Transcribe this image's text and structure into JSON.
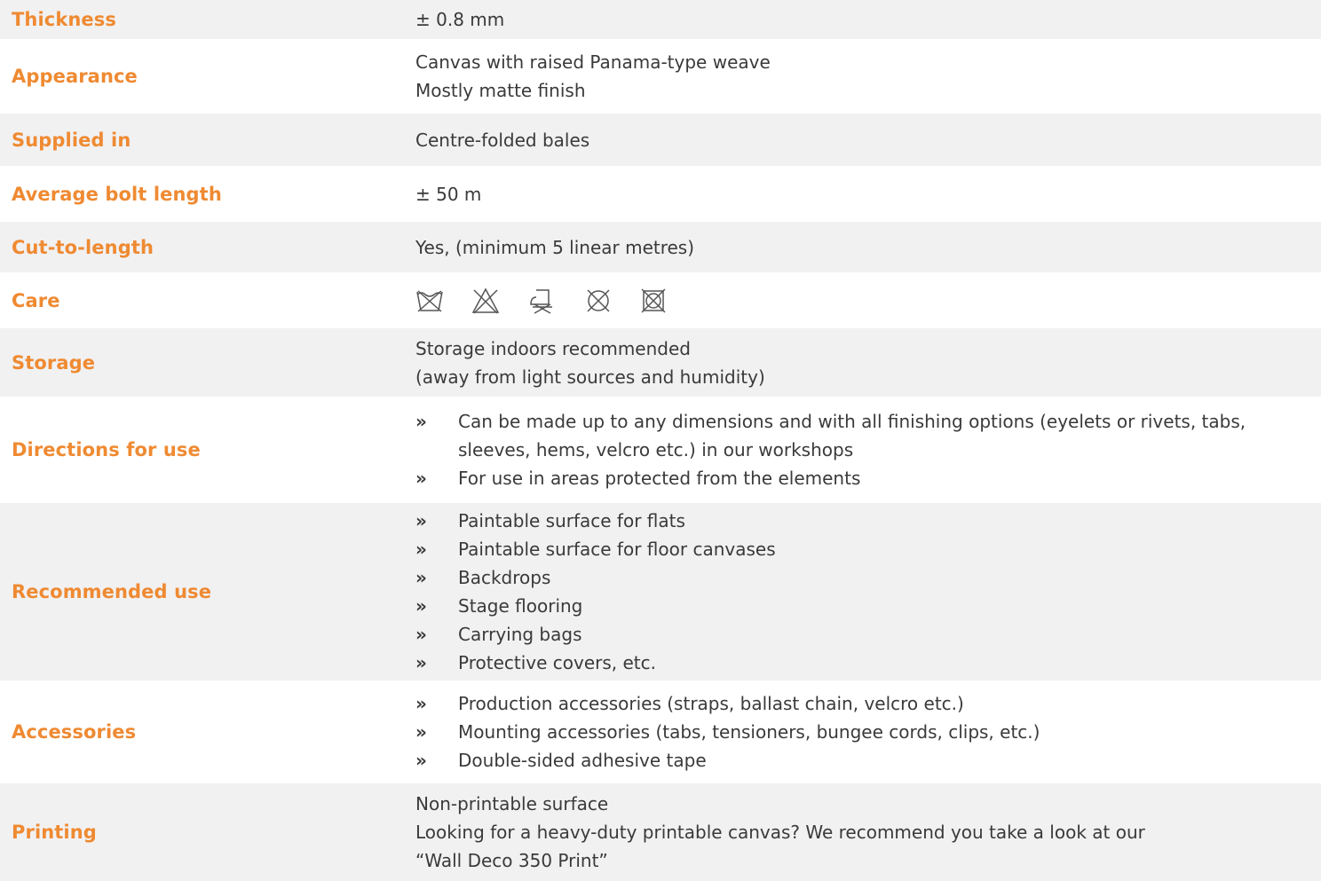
{
  "rows": [
    {
      "label": "Thickness",
      "value": "± 0.8 mm"
    },
    {
      "label": "Appearance",
      "lines": [
        "Canvas with raised Panama-type weave",
        "Mostly matte finish"
      ]
    },
    {
      "label": "Supplied in",
      "value": "Centre-folded bales"
    },
    {
      "label": "Average bolt length",
      "value": "± 50 m"
    },
    {
      "label": "Cut-to-length",
      "value": "Yes, (minimum 5 linear metres)"
    },
    {
      "label": "Care",
      "icons": [
        "do-not-wash-icon",
        "do-not-bleach-icon",
        "do-not-iron-icon",
        "do-not-dry-clean-icon",
        "do-not-tumble-dry-icon"
      ]
    },
    {
      "label": "Storage",
      "lines": [
        "Storage indoors recommended",
        "(away from light sources and humidity)"
      ]
    },
    {
      "label": "Directions for use",
      "bullets": [
        "Can be made up to any dimensions and with all finishing options (eyelets or rivets, tabs, sleeves, hems, velcro etc.) in our workshops",
        "For use in areas protected from the elements"
      ]
    },
    {
      "label": "Recommended use",
      "bullets": [
        "Paintable surface for flats",
        "Paintable surface for floor canvases",
        "Backdrops",
        "Stage flooring",
        "Carrying bags",
        "Protective covers, etc."
      ]
    },
    {
      "label": "Accessories",
      "bullets": [
        "Production accessories (straps, ballast chain, velcro etc.)",
        "Mounting accessories (tabs, tensioners, bungee cords, clips, etc.)",
        "Double-sided adhesive tape"
      ]
    },
    {
      "label": "Printing",
      "lines": [
        "Non-printable surface",
        "Looking for a heavy-duty printable canvas? We recommend you take a look at our",
        "“Wall Deco 350 Print”"
      ]
    }
  ],
  "bullet_glyph": "»",
  "colors": {
    "label": "#ef8a32",
    "text": "#3a3a3a",
    "row_shade": "#f1f1f2"
  }
}
